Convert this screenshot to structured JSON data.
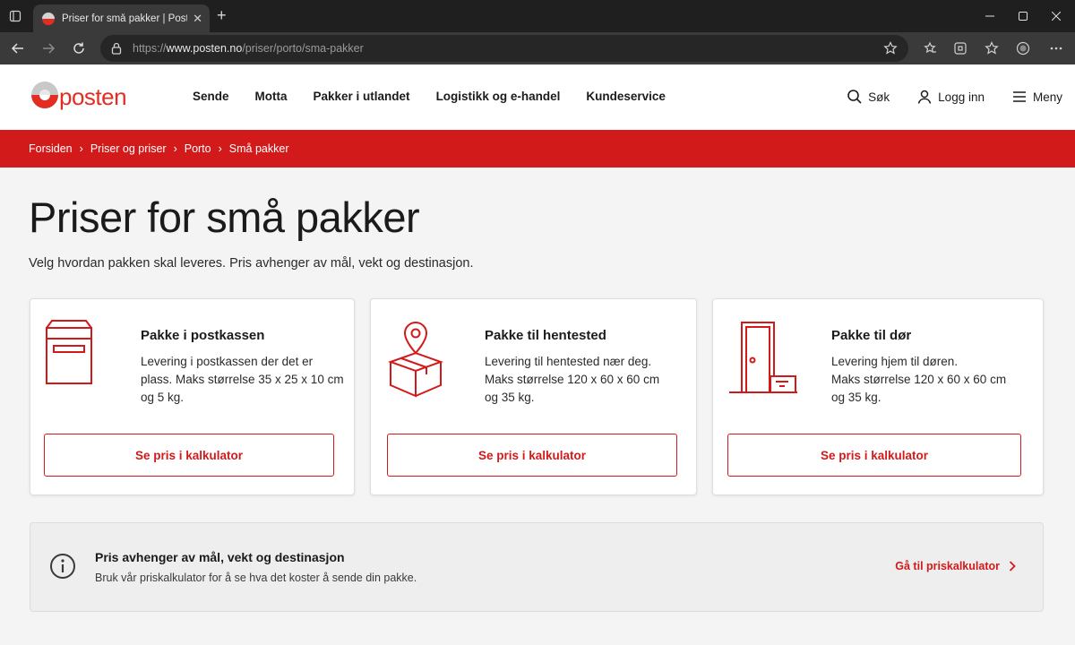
{
  "browser": {
    "tab_title": "Priser for små pakker | Posten.no",
    "url_prefix": "https://",
    "url_host": "www.posten.no",
    "url_path": "/priser/porto/sma-pakker"
  },
  "site": {
    "logo_text": "posten",
    "nav": [
      "Sende",
      "Motta",
      "Pakker i utlandet",
      "Logistikk og e-handel",
      "Kundeservice"
    ],
    "search_label": "Søk",
    "login_label": "Logg inn",
    "menu_label": "Meny"
  },
  "breadcrumb": [
    "Forsiden",
    "Priser og priser",
    "Porto",
    "Små pakker"
  ],
  "page": {
    "title": "Priser for små pakker",
    "intro": "Velg hvordan pakken skal leveres. Pris avhenger av mål, vekt og destinasjon."
  },
  "cards": [
    {
      "icon": "mailbox-icon",
      "title": "Pakke i postkassen",
      "desc": [
        "Levering i postkassen der det er",
        "plass. Maks størrelse 35 x 25 x 10 cm",
        "og 5 kg."
      ],
      "button": "Se pris i kalkulator"
    },
    {
      "icon": "pickup-point-icon",
      "title": "Pakke til hentested",
      "desc": [
        "Levering til hentested nær deg.",
        "Maks størrelse 120 x 60 x 60 cm",
        "og 35 kg."
      ],
      "button": "Se pris i kalkulator"
    },
    {
      "icon": "door-delivery-icon",
      "title": "Pakke til dør",
      "desc": [
        "Levering hjem til døren.",
        "Maks størrelse 120 x 60 x 60 cm",
        "og 35 kg."
      ],
      "button": "Se pris i kalkulator"
    }
  ],
  "info": {
    "title": "Pris avhenger av mål, vekt og destinasjon",
    "text": "Bruk vår priskalkulator for å se hva det koster å sende din pakke.",
    "link": "Gå til priskalkulator"
  },
  "colors": {
    "brand_red": "#d31a1a",
    "logo_red": "#e32d22"
  }
}
